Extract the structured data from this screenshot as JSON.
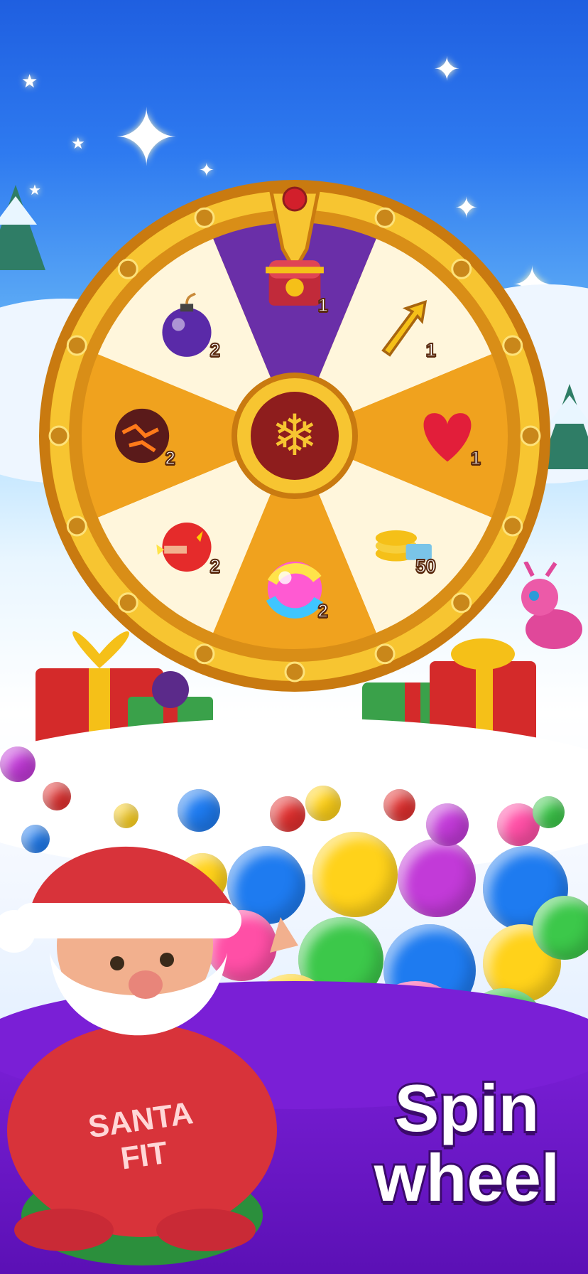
{
  "banner": {
    "line1": "Spin",
    "line2": "wheel"
  },
  "wheel": {
    "prizes": [
      {
        "name": "chest-icon",
        "count": "1"
      },
      {
        "name": "arrow-icon",
        "count": "1"
      },
      {
        "name": "heart-icon",
        "count": "1"
      },
      {
        "name": "coins-icon",
        "count": "50"
      },
      {
        "name": "rainbow-bubble-icon",
        "count": "2"
      },
      {
        "name": "firework-bomb-icon",
        "count": "2"
      },
      {
        "name": "lava-ball-icon",
        "count": "2"
      },
      {
        "name": "bomb-icon",
        "count": "2"
      }
    ]
  },
  "character": {
    "shirt_line1": "SANTA",
    "shirt_line2": "FIT"
  },
  "colors": {
    "wheel_rim": "#f2b51a",
    "segment_light": "#fff6dc",
    "segment_orange": "#f0a21e",
    "segment_purple": "#6a2fa8",
    "banner": "#7a1fd6"
  }
}
